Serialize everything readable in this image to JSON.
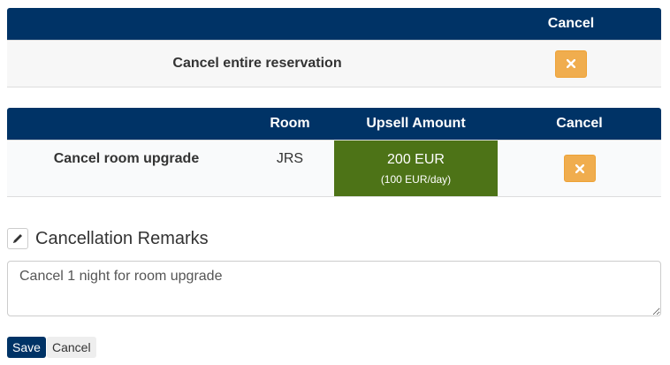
{
  "reservation_table": {
    "header_cancel": "Cancel",
    "row_label": "Cancel entire reservation",
    "cancel_icon": "close-icon"
  },
  "upgrade_table": {
    "header_room": "Room",
    "header_upsell": "Upsell Amount",
    "header_cancel": "Cancel",
    "row_label": "Cancel room upgrade",
    "room": "JRS",
    "upsell_amount": "200 EUR",
    "upsell_per_day": "(100 EUR/day)",
    "upsell_color": "#4d7317",
    "cancel_icon": "close-icon"
  },
  "remarks": {
    "icon": "pencil-icon",
    "title": "Cancellation Remarks",
    "value": "Cancel 1 night for room upgrade"
  },
  "actions": {
    "save_label": "Save",
    "cancel_label": "Cancel"
  },
  "colors": {
    "header_bg": "#003366",
    "cancel_button": "#f0ad4e",
    "save_button": "#003366"
  }
}
